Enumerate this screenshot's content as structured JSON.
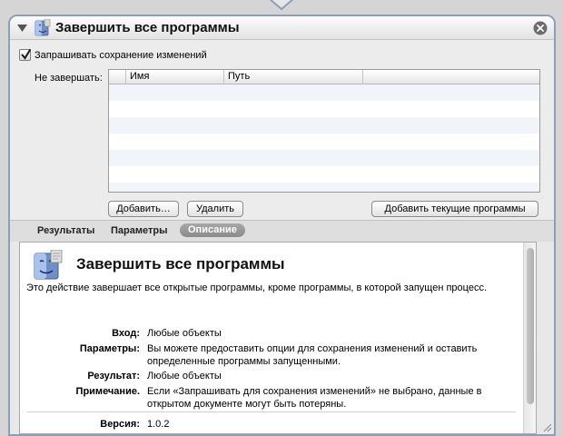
{
  "action": {
    "title": "Завершить все программы",
    "ask_to_save_label": "Запрашивать сохранение изменений",
    "ask_to_save_checked": true,
    "do_not_quit_label": "Не завершать:",
    "table": {
      "columns": [
        "Имя",
        "Путь"
      ],
      "rows": []
    },
    "buttons": {
      "add": "Добавить…",
      "remove": "Удалить",
      "add_current": "Добавить текущие программы"
    }
  },
  "tabs": [
    {
      "label": "Результаты",
      "selected": false
    },
    {
      "label": "Параметры",
      "selected": false
    },
    {
      "label": "Описание",
      "selected": true
    }
  ],
  "description": {
    "title": "Завершить все программы",
    "summary": "Это действие завершает все открытые программы, кроме программы, в которой запущен процесс.",
    "input_label": "Вход:",
    "input_value": "Любые объекты",
    "options_label": "Параметры:",
    "options_value": "Вы можете предоставить опции для сохранения изменений и оставить определенные программы запущенными.",
    "result_label": "Результат:",
    "result_value": "Любые объекты",
    "note_label": "Примечание.",
    "note_value": "Если «Запрашивать для сохранения изменений» не выбрано, данные в открытом документе могут быть потеряны.",
    "version_label": "Версия:",
    "version_value": "1.0.2"
  },
  "colors": {
    "card_border": "#8b9fb7",
    "selected_tab": "#8f8f8f",
    "alt_row": "#f1f5fa"
  },
  "icons": {
    "disclosure": "disclosure-triangle-icon",
    "app": "finder-app-icon",
    "close": "close-circle-icon"
  }
}
